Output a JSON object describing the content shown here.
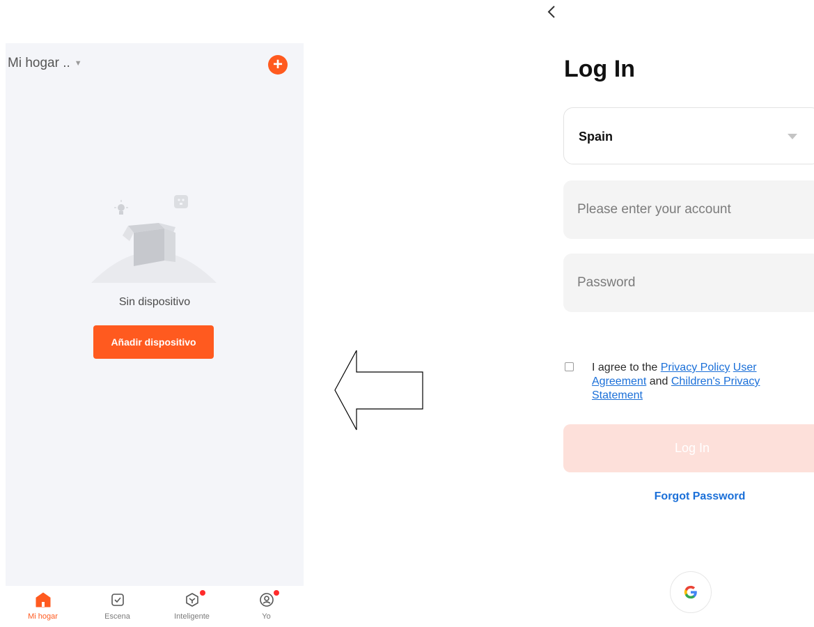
{
  "left_app": {
    "home_selector": "Mi hogar ..",
    "empty_state": {
      "message": "Sin dispositivo",
      "add_button": "Añadir dispositivo"
    },
    "tabs": [
      {
        "label": "Mi hogar",
        "icon": "home-icon",
        "active": true
      },
      {
        "label": "Escena",
        "icon": "scene-checkbox-icon",
        "active": false
      },
      {
        "label": "Inteligente",
        "icon": "smart-cube-icon",
        "active": false,
        "badge": true
      },
      {
        "label": "Yo",
        "icon": "profile-icon",
        "active": false,
        "badge": true
      }
    ]
  },
  "login_screen": {
    "title": "Log In",
    "country": "Spain",
    "account_placeholder": "Please enter your account",
    "password_placeholder": "Password",
    "agreement": {
      "prefix": "I agree to the",
      "privacy_policy": "Privacy Policy",
      "user_agreement": "User Agreement",
      "and": "and",
      "childrens_privacy": "Children's Privacy Statement"
    },
    "login_button": "Log In",
    "forgot_password": "Forgot Password"
  },
  "colors": {
    "accent": "#ff5a1f",
    "login_button_disabled": "#fde0da",
    "link": "#1a6fd8",
    "background_left": "#f4f5f9"
  }
}
